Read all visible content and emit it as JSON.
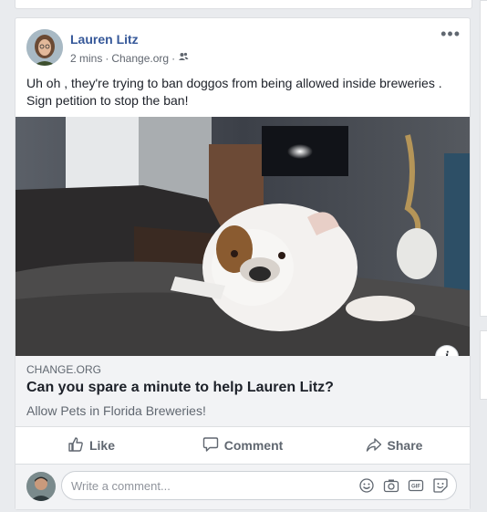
{
  "post": {
    "author": "Lauren Litz",
    "time": "2 mins",
    "via": "Change.org",
    "separator": "·",
    "audience_icon": "friends-icon",
    "more_icon": "more-options-icon",
    "text": "Uh oh , they're trying to ban doggos from being allowed inside breweries . Sign petition to stop the ban!",
    "photo_subject": "bulldog-lying-on-rug"
  },
  "link": {
    "domain": "CHANGE.ORG",
    "title": "Can you spare a minute to help Lauren Litz?",
    "description": "Allow Pets in Florida Breweries!",
    "info_label": "i"
  },
  "actions": {
    "like": "Like",
    "comment": "Comment",
    "share": "Share"
  },
  "comment_box": {
    "placeholder": "Write a comment...",
    "icons": [
      "emoji-icon",
      "camera-icon",
      "gif-icon",
      "sticker-icon"
    ]
  },
  "colors": {
    "author": "#365899",
    "background": "#e9ebee",
    "muted": "#606770"
  }
}
